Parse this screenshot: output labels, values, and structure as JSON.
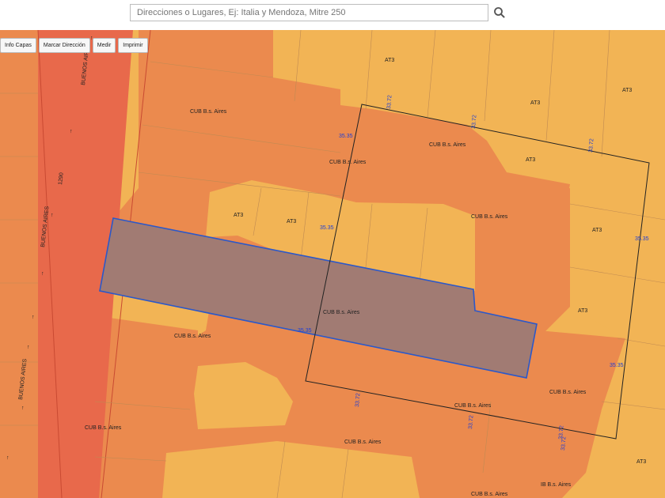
{
  "search": {
    "placeholder": "Direcciones o Lugares, Ej: Italia y Mendoza, Mitre 250"
  },
  "toolbar": {
    "info_label": "Info Capas",
    "mark_label": "Marcar Dirección",
    "measure_label": "Medir",
    "print_label": "Imprimir"
  },
  "map": {
    "colors": {
      "at3": "#f2b455",
      "cub": "#eb8a4e",
      "avenue": "#e8694b",
      "selected_parcel": "#a17b73",
      "selected_outline": "#2b58c9",
      "dimension_text": "#1f3fd6"
    },
    "zone_labels": {
      "at3": "AT3",
      "cub": "CUB B.s. Aires",
      "cub_alt": "IB B.s. Aires"
    },
    "street": {
      "name": "BUENOS AIRES",
      "number": "1290"
    },
    "dimensions": {
      "d1": "35.35",
      "d2": "33.72",
      "d3": "35.35",
      "d4": "35.35",
      "d5": "33.72",
      "d6": "33.72",
      "d7": "35.35",
      "d8": "33.72",
      "d9": "33.72",
      "d10": "33.72",
      "d11": "33.72",
      "d12": "35.35"
    }
  }
}
